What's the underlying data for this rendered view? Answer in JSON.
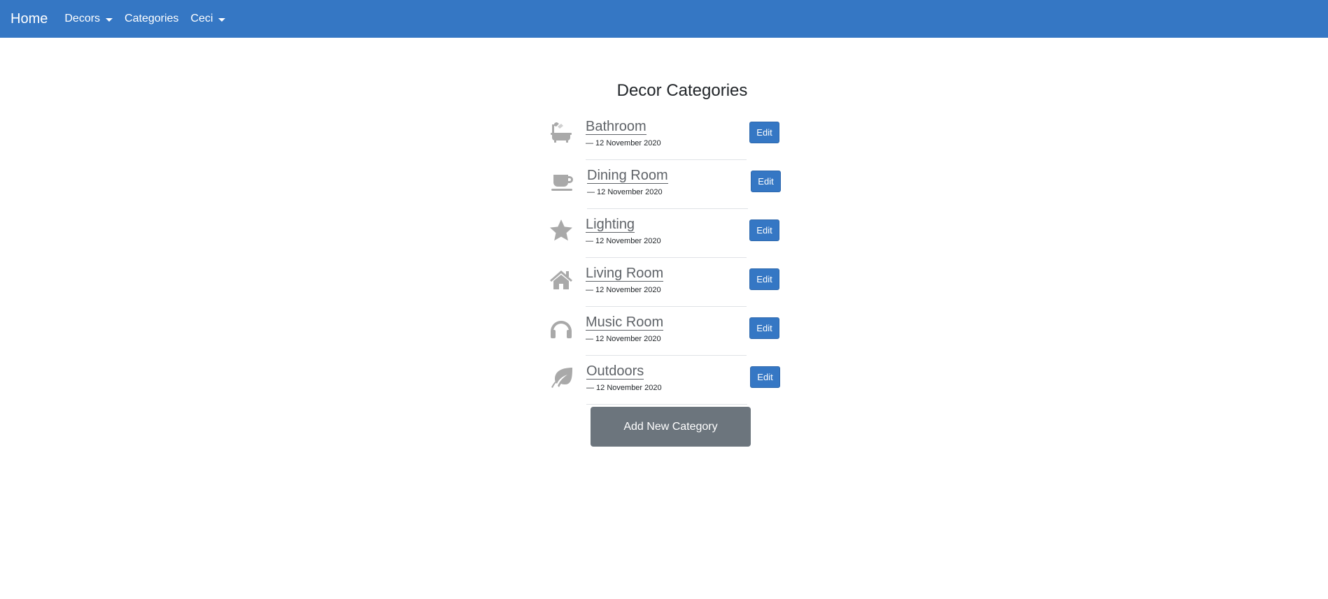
{
  "navbar": {
    "brand": "Home",
    "links": [
      {
        "label": "Decors",
        "dropdown": true
      },
      {
        "label": "Categories",
        "dropdown": false
      },
      {
        "label": "Ceci",
        "dropdown": true
      }
    ]
  },
  "main": {
    "title": "Decor Categories",
    "categories": [
      {
        "name": "Bathroom",
        "date": "— 12 November 2020",
        "icon": "bath-icon",
        "edit_label": "Edit"
      },
      {
        "name": "Dining Room",
        "date": "— 12 November 2020",
        "icon": "coffee-cup-icon",
        "edit_label": "Edit"
      },
      {
        "name": "Lighting",
        "date": "— 12 November 2020",
        "icon": "star-icon",
        "edit_label": "Edit"
      },
      {
        "name": "Living Room",
        "date": "— 12 November 2020",
        "icon": "home-icon",
        "edit_label": "Edit"
      },
      {
        "name": "Music Room",
        "date": "— 12 November 2020",
        "icon": "headphones-icon",
        "edit_label": "Edit"
      },
      {
        "name": "Outdoors",
        "date": "— 12 November 2020",
        "icon": "leaf-icon",
        "edit_label": "Edit"
      }
    ],
    "add_button": "Add New Category"
  },
  "colors": {
    "navbar_bg": "#3577c4",
    "edit_button_bg": "#3577c4",
    "add_button_bg": "#6c757d",
    "icon_color": "#a9a9a9"
  }
}
